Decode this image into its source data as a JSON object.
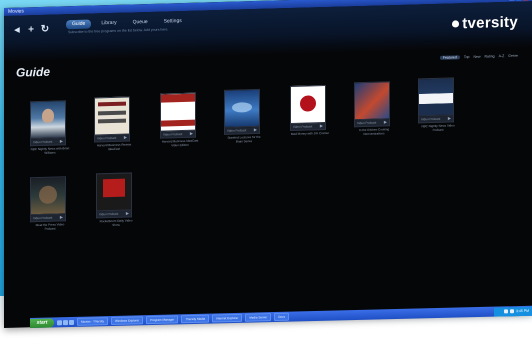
{
  "window": {
    "title": "Movies",
    "controls": [
      "_",
      "□",
      "×"
    ]
  },
  "app": {
    "brand": "tversity",
    "nav_icons": [
      "back-icon",
      "add-icon",
      "refresh-icon"
    ],
    "tabs": [
      {
        "label": "Guide",
        "active": true
      },
      {
        "label": "Library",
        "active": false
      },
      {
        "label": "Queue",
        "active": false
      },
      {
        "label": "Settings",
        "active": false
      }
    ],
    "hint": "Subscribe to the free programs on the list below. Add yours here."
  },
  "page": {
    "title": "Guide",
    "subnav": [
      "Featured",
      "Top",
      "New",
      "Rating",
      "A-Z",
      "Genre"
    ]
  },
  "tiles": [
    {
      "caption": "NBC Nightly News with Brian Williams",
      "bar": "Video Podcast"
    },
    {
      "caption": "Harvard Business Review IdeaCast",
      "bar": "Video Podcast"
    },
    {
      "caption": "Harvard Business IdeaCast Video Edition",
      "bar": "Video Podcast"
    },
    {
      "caption": "Stanford Lectures for the Brain Series",
      "bar": "Video Podcast"
    },
    {
      "caption": "Mad Money with Jim Cramer",
      "bar": "Video Podcast"
    },
    {
      "caption": "In the Kitchen Cooking Demonstrations",
      "bar": "Video Podcast"
    },
    {
      "caption": "NBC Nightly News Video Podcast",
      "bar": "Video Podcast"
    },
    {
      "caption": "Meet the Press Video Podcast",
      "bar": "Video Podcast"
    },
    {
      "caption": "Rocketboom Daily Video Show",
      "bar": "Video Podcast"
    }
  ],
  "taskbar": {
    "start": "start",
    "tasks": [
      "Movies - TVersity",
      "Windows Explorer",
      "Program Manager",
      "TVersity Media",
      "Internet Explorer",
      "Media Server",
      "Docs"
    ],
    "clock": "3:45 PM"
  },
  "colors": {
    "backdrop": "#39b9ea",
    "screen_bg": "#050608",
    "tab_active": "#4e7fbf",
    "xp_taskbar": "#1f4fc5"
  }
}
